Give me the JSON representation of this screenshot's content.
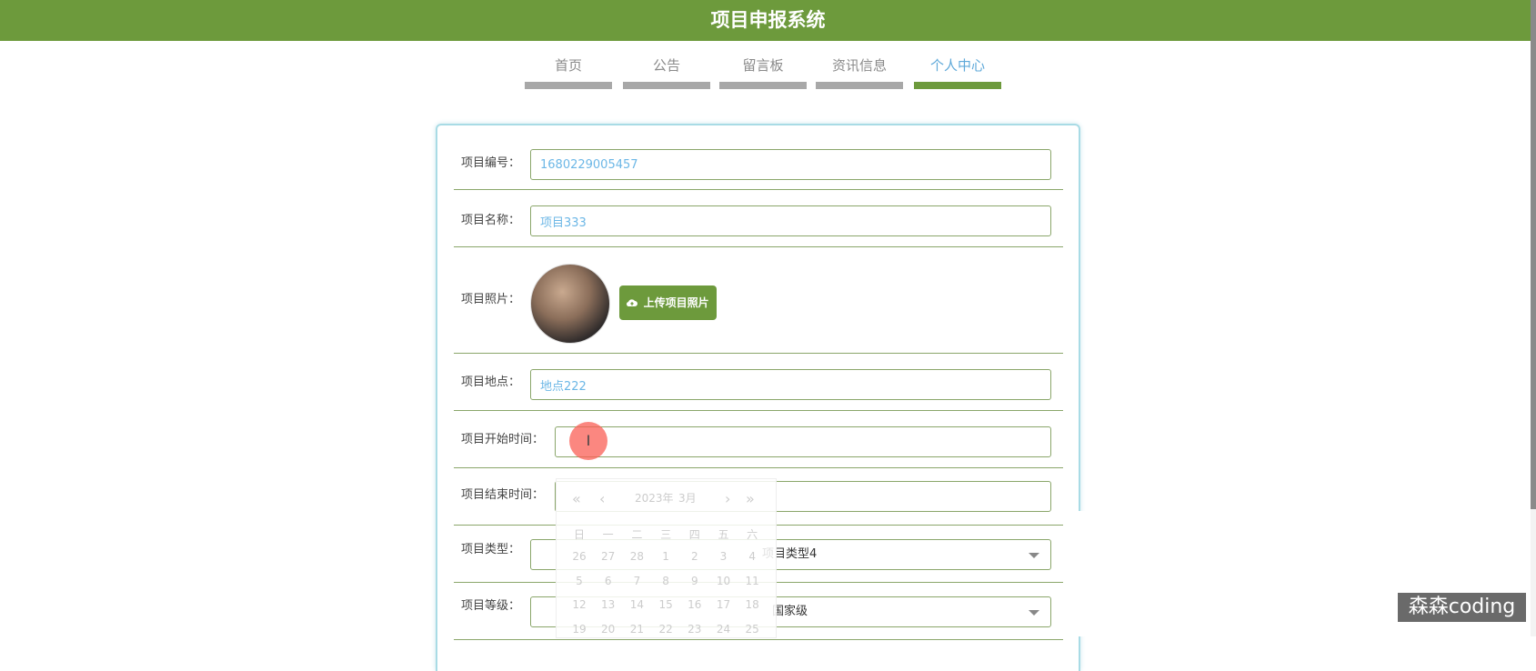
{
  "header": {
    "title": "项目申报系统"
  },
  "nav": {
    "items": [
      {
        "label": "首页"
      },
      {
        "label": "公告"
      },
      {
        "label": "留言板"
      },
      {
        "label": "资讯信息"
      },
      {
        "label": "个人中心"
      }
    ],
    "active_index": 4
  },
  "form": {
    "project_no": {
      "label": "项目编号：",
      "value": "1680229005457"
    },
    "project_name": {
      "label": "项目名称：",
      "value": "项目333"
    },
    "project_photo": {
      "label": "项目照片：",
      "upload_label": "上传项目照片"
    },
    "project_location": {
      "label": "项目地点：",
      "value": "地点222"
    },
    "start_time": {
      "label": "项目开始时间：",
      "value": ""
    },
    "end_time": {
      "label": "项目结束时间：",
      "value": ""
    },
    "project_type": {
      "label": "项目类型：",
      "value": "项目类型4"
    },
    "project_level": {
      "label": "项目等级：",
      "value": "国家级"
    }
  },
  "datepicker": {
    "year": "2023年",
    "month": "3月",
    "weekdays": [
      "日",
      "一",
      "二",
      "三",
      "四",
      "五",
      "六"
    ],
    "rows": [
      [
        "26",
        "27",
        "28",
        "1",
        "2",
        "3",
        "4"
      ],
      [
        "5",
        "6",
        "7",
        "8",
        "9",
        "10",
        "11"
      ],
      [
        "12",
        "13",
        "14",
        "15",
        "16",
        "17",
        "18"
      ],
      [
        "19",
        "20",
        "21",
        "22",
        "23",
        "24",
        "25"
      ]
    ]
  },
  "cursor": {
    "glyph": "I"
  },
  "watermark": {
    "text": "森森coding"
  },
  "colors": {
    "brand_green": "#6d9a3c",
    "link_blue": "#5fa9d9",
    "border_blue": "#a8dbe5"
  }
}
